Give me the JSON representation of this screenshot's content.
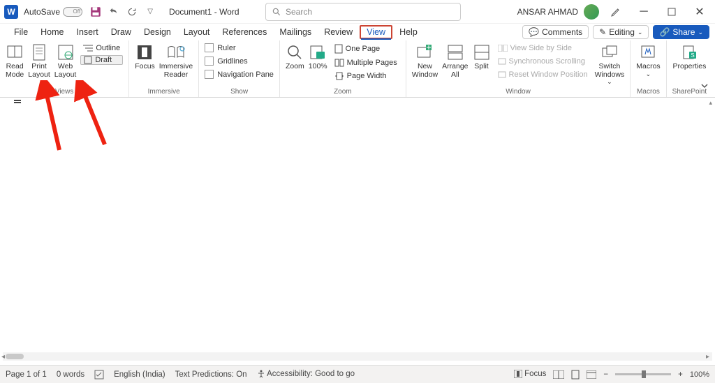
{
  "title_bar": {
    "app_icon_letter": "W",
    "autosave_label": "AutoSave",
    "autosave_state": "Off",
    "doc_title": "Document1 - Word",
    "search_placeholder": "Search",
    "user_name": "ANSAR AHMAD"
  },
  "tabs": {
    "file": "File",
    "home": "Home",
    "insert": "Insert",
    "draw": "Draw",
    "design": "Design",
    "layout": "Layout",
    "references": "References",
    "mailings": "Mailings",
    "review": "Review",
    "view": "View",
    "help": "Help"
  },
  "tabs_right": {
    "comments": "Comments",
    "editing": "Editing",
    "share": "Share"
  },
  "ribbon": {
    "views": {
      "read_mode": "Read\nMode",
      "print_layout": "Print\nLayout",
      "web_layout": "Web\nLayout",
      "outline": "Outline",
      "draft": "Draft",
      "group_label": "Views"
    },
    "immersive": {
      "focus": "Focus",
      "immersive_reader": "Immersive\nReader",
      "group_label": "Immersive"
    },
    "show": {
      "ruler": "Ruler",
      "gridlines": "Gridlines",
      "nav_pane": "Navigation Pane",
      "group_label": "Show"
    },
    "zoom": {
      "zoom": "Zoom",
      "hundred": "100%",
      "one_page": "One Page",
      "multi_pages": "Multiple Pages",
      "page_width": "Page Width",
      "group_label": "Zoom"
    },
    "window": {
      "new_window": "New\nWindow",
      "arrange_all": "Arrange\nAll",
      "split": "Split",
      "view_side": "View Side by Side",
      "sync_scroll": "Synchronous Scrolling",
      "reset_pos": "Reset Window Position",
      "switch_windows": "Switch\nWindows",
      "group_label": "Window"
    },
    "macros": {
      "macros": "Macros",
      "group_label": "Macros"
    },
    "sharepoint": {
      "properties": "Properties",
      "group_label": "SharePoint"
    }
  },
  "status": {
    "page": "Page 1 of 1",
    "words": "0 words",
    "lang": "English (India)",
    "predict": "Text Predictions: On",
    "access": "Accessibility: Good to go",
    "focus": "Focus",
    "zoom": "100%"
  }
}
